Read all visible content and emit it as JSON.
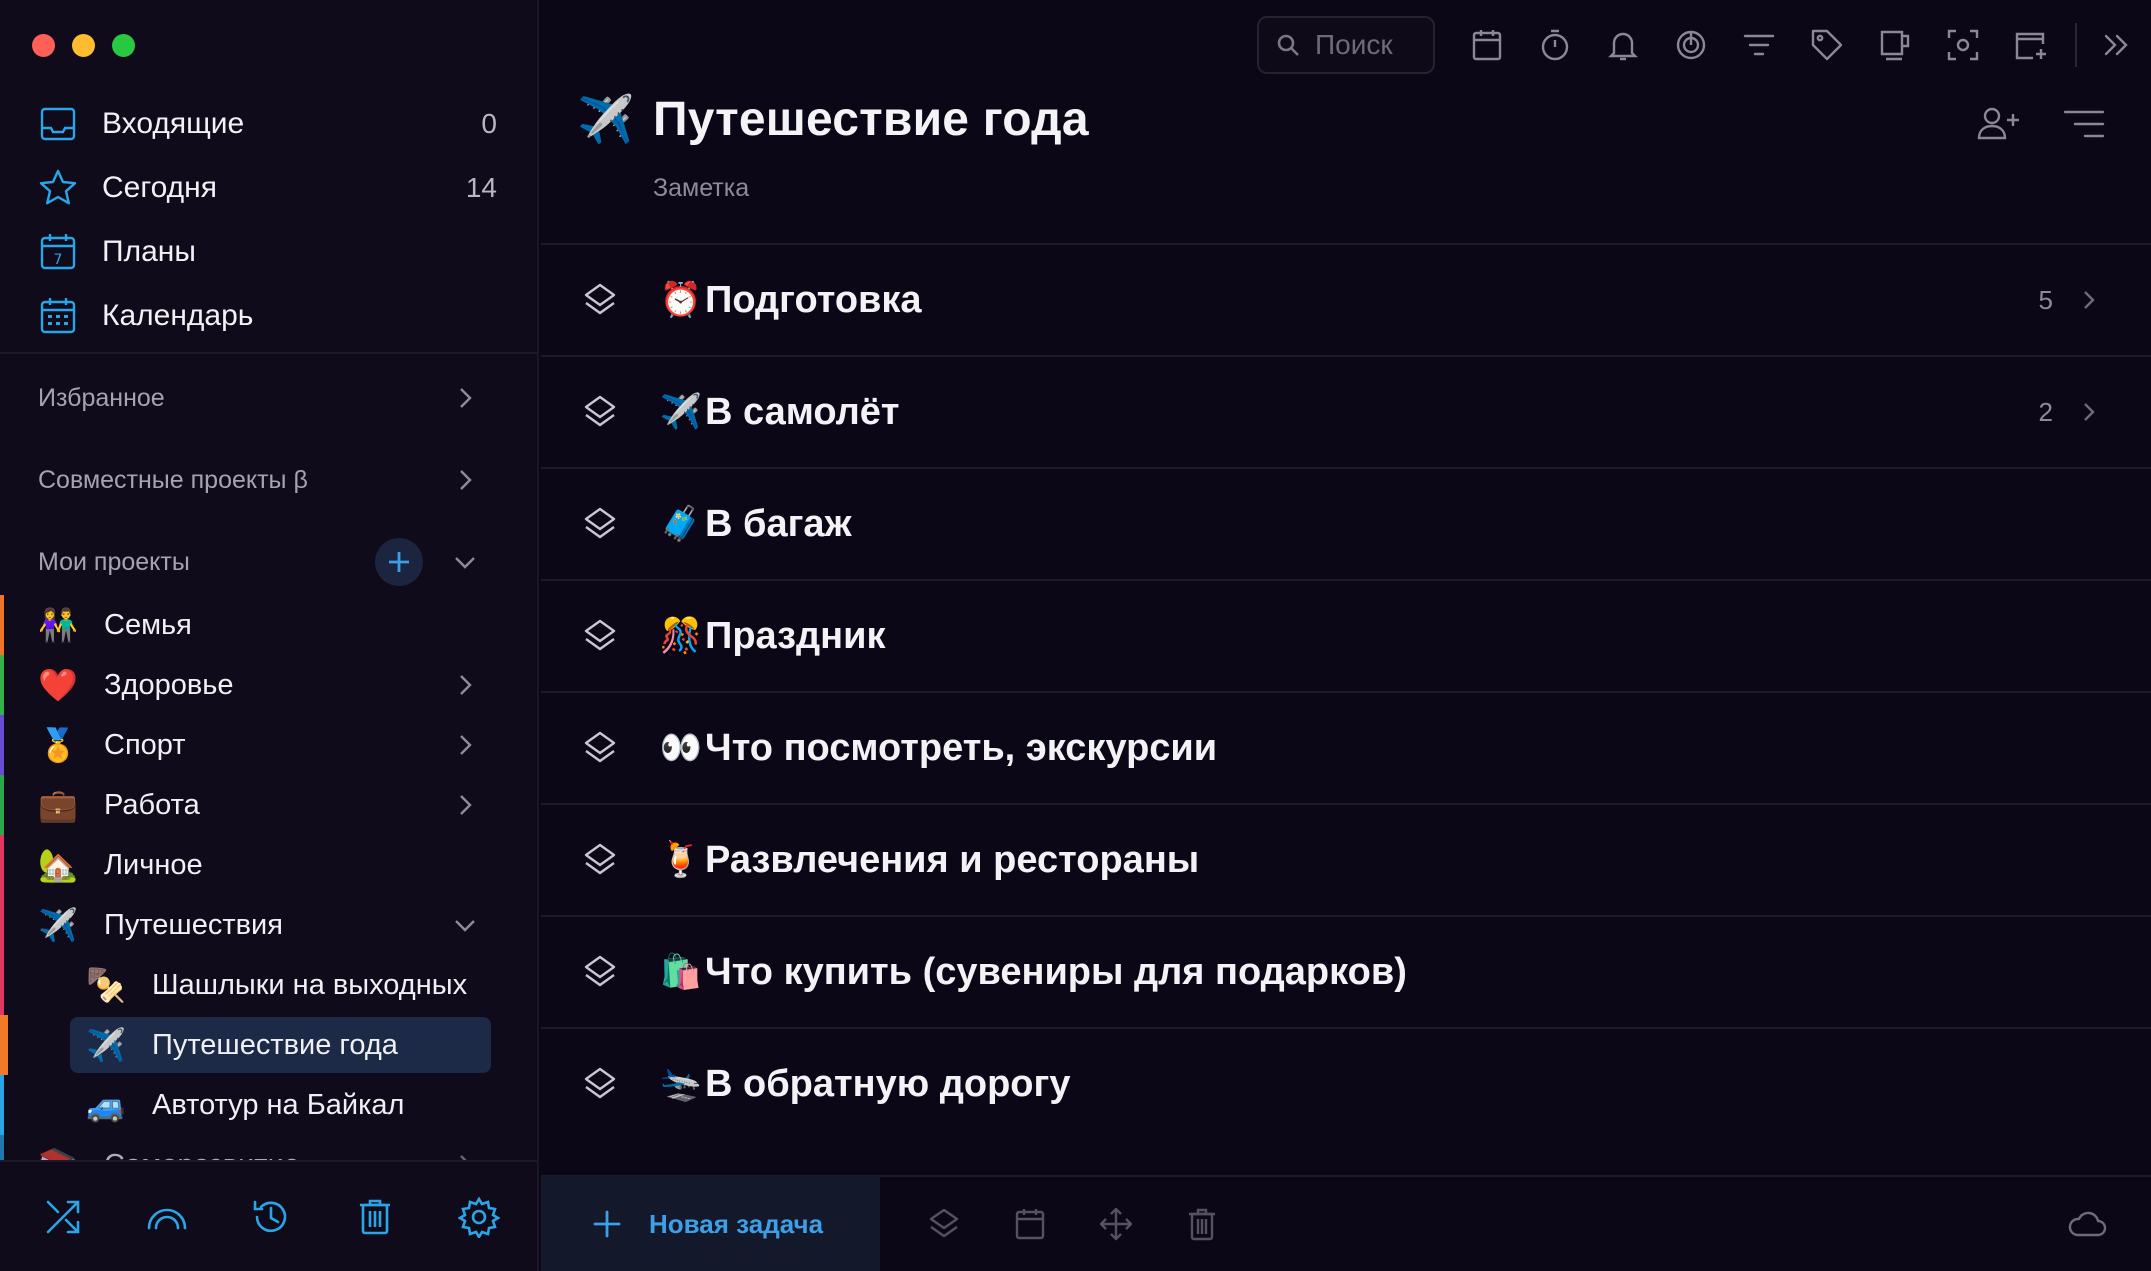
{
  "sidebar": {
    "nav": [
      {
        "label": "Входящие",
        "count": "0",
        "icon": "inbox-icon"
      },
      {
        "label": "Сегодня",
        "count": "14",
        "icon": "star-icon"
      },
      {
        "label": "Планы",
        "count": "",
        "icon": "calendar-7-icon"
      },
      {
        "label": "Календарь",
        "count": "",
        "icon": "calendar-grid-icon"
      }
    ],
    "favorites_label": "Избранное",
    "shared_label": "Совместные проекты β",
    "my_projects_label": "Мои проекты",
    "projects": [
      {
        "emoji": "👫",
        "label": "Семья",
        "color": "#f0732a",
        "has_children": false
      },
      {
        "emoji": "❤️",
        "label": "Здоровье",
        "color": "#36b24a",
        "has_children": true
      },
      {
        "emoji": "🏅",
        "label": "Спорт",
        "color": "#6a4bd6",
        "has_children": true
      },
      {
        "emoji": "💼",
        "label": "Работа",
        "color": "#2ba94a",
        "has_children": true
      },
      {
        "emoji": "🏡",
        "label": "Личное",
        "color": "#e0365f",
        "has_children": false
      },
      {
        "emoji": "✈️",
        "label": "Путешествия",
        "color": "#e0365f",
        "expanded": true
      },
      {
        "emoji": "🍢",
        "label": "Шашлыки на выходных",
        "color": "#e0365f"
      },
      {
        "emoji": "✈️",
        "label": "Путешествие года",
        "color": "#f07a2a",
        "active": true
      },
      {
        "emoji": "🚙",
        "label": "Автотур на Байкал",
        "color": "#2aa6e8"
      },
      {
        "emoji": "📚",
        "label": "Саморазвитие",
        "color": "#2aa6e8"
      }
    ],
    "bottom_icons": [
      "shuffle-icon",
      "rainbow-icon",
      "history-icon",
      "trash-icon",
      "settings-icon"
    ]
  },
  "toolbar": {
    "search_placeholder": "Поиск",
    "icons": [
      "calendar-icon",
      "timer-icon",
      "bell-icon",
      "focus-icon",
      "filter-icon",
      "tag-icon",
      "note-icon",
      "screenshot-icon",
      "add-window-icon",
      "expand-icon"
    ]
  },
  "header": {
    "emoji": "✈️",
    "title": "Путешествие года",
    "subtitle": "Заметка"
  },
  "tasks": [
    {
      "emoji": "⏰",
      "label": "Подготовка",
      "count": "5",
      "has_arrow": true
    },
    {
      "emoji": "✈️",
      "label": "В самолёт",
      "count": "2",
      "has_arrow": true
    },
    {
      "emoji": "🧳",
      "label": "В багаж",
      "count": "",
      "has_arrow": false
    },
    {
      "emoji": "🎊",
      "label": "Праздник",
      "count": "",
      "has_arrow": false
    },
    {
      "emoji": "👀",
      "label": "Что посмотреть, экскурсии",
      "count": "",
      "has_arrow": false
    },
    {
      "emoji": "🍹",
      "label": "Развлечения и рестораны",
      "count": "",
      "has_arrow": false
    },
    {
      "emoji": "🛍️",
      "label": "Что купить (сувениры для подарков)",
      "count": "",
      "has_arrow": false
    },
    {
      "emoji": "🛬",
      "label": "В обратную дорогу",
      "count": "",
      "has_arrow": false
    }
  ],
  "bottombar": {
    "new_task_label": "Новая задача"
  },
  "colors": {
    "accent": "#2aa6e8",
    "background": "#0c0717",
    "sidebar": "#0f0b1b",
    "active_item": "#1c2a48"
  }
}
